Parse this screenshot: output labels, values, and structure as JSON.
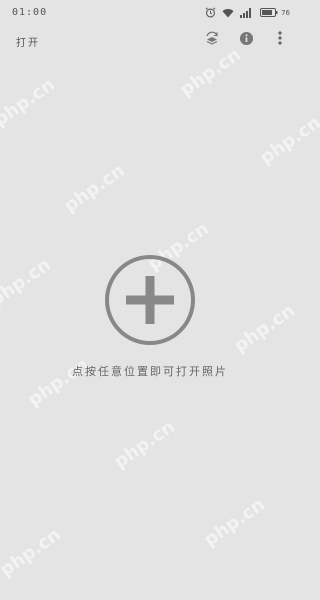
{
  "status_bar": {
    "time": "01:00",
    "battery_percent": "76",
    "icons": [
      "alarm-icon",
      "wifi-icon",
      "signal-icon",
      "battery-icon"
    ]
  },
  "toolbar": {
    "title": "打开",
    "actions": [
      "rotate-layers-icon",
      "info-icon",
      "more-vert-icon"
    ]
  },
  "main": {
    "add_icon": "plus-circle-icon",
    "hint": "点按任意位置即可打开照片"
  },
  "watermark": {
    "text": "php.cn"
  },
  "colors": {
    "background": "#e4e4e4",
    "icon": "#888888",
    "text": "#555555"
  }
}
